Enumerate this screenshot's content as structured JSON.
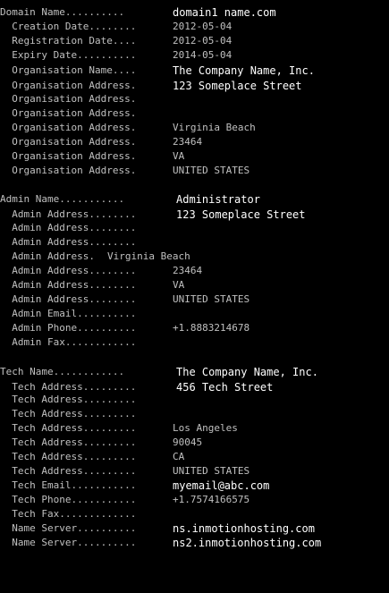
{
  "domain": {
    "label": "Domain Name..........",
    "value": "domain1 name.com",
    "creation_label": "  Creation Date........",
    "creation_value": "2012-05-04",
    "registration_label": "  Registration Date....",
    "registration_value": "2012-05-04",
    "expiry_label": "  Expiry Date..........",
    "expiry_value": "2014-05-04"
  },
  "organisation": {
    "name_label": "  Organisation Name....",
    "name_value": "The Company Name, Inc.",
    "address_label": "  Organisation Address.",
    "addresses": [
      "123 Someplace Street",
      "",
      "",
      "Virginia Beach",
      "23464",
      "VA",
      "UNITED STATES"
    ]
  },
  "admin": {
    "name_label": "Admin Name...........",
    "name_value": "Administrator",
    "address_label": "  Admin Address........",
    "address_label_4": "  Admin Address.",
    "addresses": [
      "123 Someplace Street",
      "",
      "",
      "Virginia Beach",
      "23464",
      "VA",
      "UNITED STATES"
    ],
    "email_label": "  Admin Email..........",
    "email_value": "",
    "phone_label": "  Admin Phone..........",
    "phone_value": "+1.8883214678",
    "fax_label": "  Admin Fax............",
    "fax_value": ""
  },
  "tech": {
    "name_label": "Tech Name............",
    "name_value": "The Company Name, Inc.",
    "address_label": "  Tech Address.........",
    "addresses": [
      "456 Tech Street",
      "",
      "",
      "Los Angeles",
      "90045",
      "CA",
      "UNITED STATES"
    ],
    "email_label": "  Tech Email...........",
    "email_value": "myemail@abc.com",
    "phone_label": "  Tech Phone...........",
    "phone_value": "+1.7574166575",
    "fax_label": "  Tech Fax.............",
    "fax_value": ""
  },
  "name_servers": {
    "label": "  Name Server..........",
    "values": [
      "ns.inmotionhosting.com",
      "ns2.inmotionhosting.com"
    ]
  },
  "colors": {
    "background": "#000000",
    "text": "#c0c0c0",
    "highlight_text": "#ffffff"
  }
}
